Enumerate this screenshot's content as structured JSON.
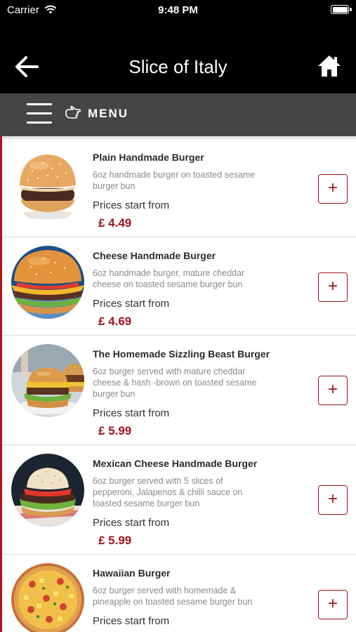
{
  "status_bar": {
    "carrier": "Carrier",
    "time": "9:48 PM"
  },
  "nav": {
    "title": "Slice of Italy"
  },
  "menu": {
    "label": "MENU"
  },
  "items": [
    {
      "name": "Plain Handmade Burger",
      "desc": "6oz handmade burger on toasted sesame burger bun",
      "price_label": "Prices start from",
      "price": "£ 4.49",
      "add": "+"
    },
    {
      "name": "Cheese Handmade Burger",
      "desc": "6oz handmade burger, mature cheddar cheese on toasted sesame burger bun",
      "price_label": "Prices start from",
      "price": "£ 4.69",
      "add": "+"
    },
    {
      "name": "The Homemade Sizzling Beast Burger",
      "desc": "6oz burger served with mature cheddar cheese & hash -brown on toasted sesame burger bun",
      "price_label": "Prices start from",
      "price": "£ 5.99",
      "add": "+"
    },
    {
      "name": "Mexican Cheese Handmade Burger",
      "desc": "6oz burger served with 5 slices of pepperoni, Jalapenos & chilli sauce on toasted sesame burger bun",
      "price_label": "Prices start from",
      "price": "£ 5.99",
      "add": "+"
    },
    {
      "name": "Hawaiian Burger",
      "desc": "6oz burger served with homemade & pineapple on toasted sesame burger bun",
      "price_label": "Prices start from",
      "price": "",
      "add": "+"
    }
  ]
}
